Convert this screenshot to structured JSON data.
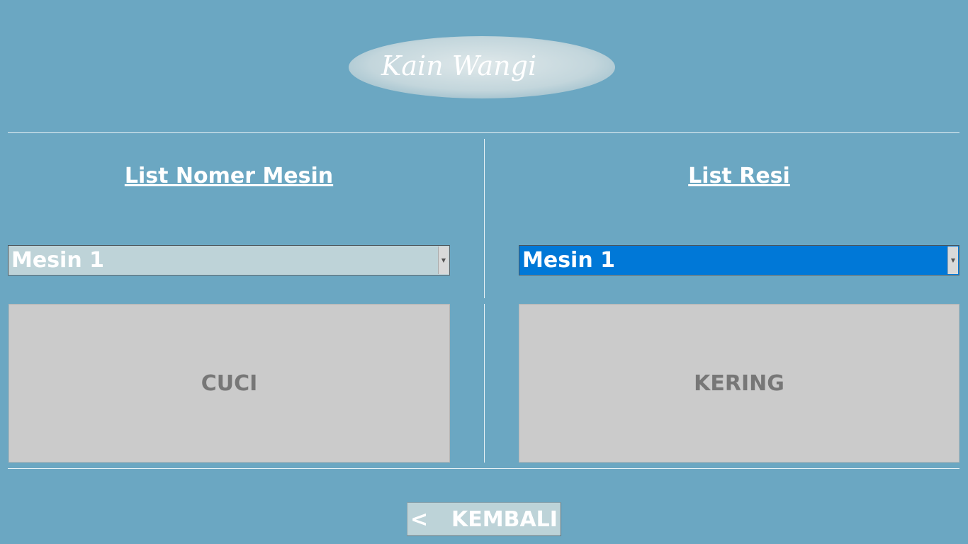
{
  "logo": {
    "text": "Kain Wangi"
  },
  "left_panel": {
    "heading": "List Nomer Mesin",
    "combo_value": "Mesin 1",
    "button_label": "CUCI"
  },
  "right_panel": {
    "heading": "List Resi",
    "combo_value": "Mesin 1",
    "button_label": "KERING"
  },
  "footer": {
    "back_chevron": "<",
    "back_label": "KEMBALI"
  },
  "colors": {
    "background": "#6ba7c2",
    "combo_left": "#bed3d8",
    "combo_right_selected": "#0078d7",
    "button": "#cbcbcb",
    "button_text": "#777777"
  }
}
